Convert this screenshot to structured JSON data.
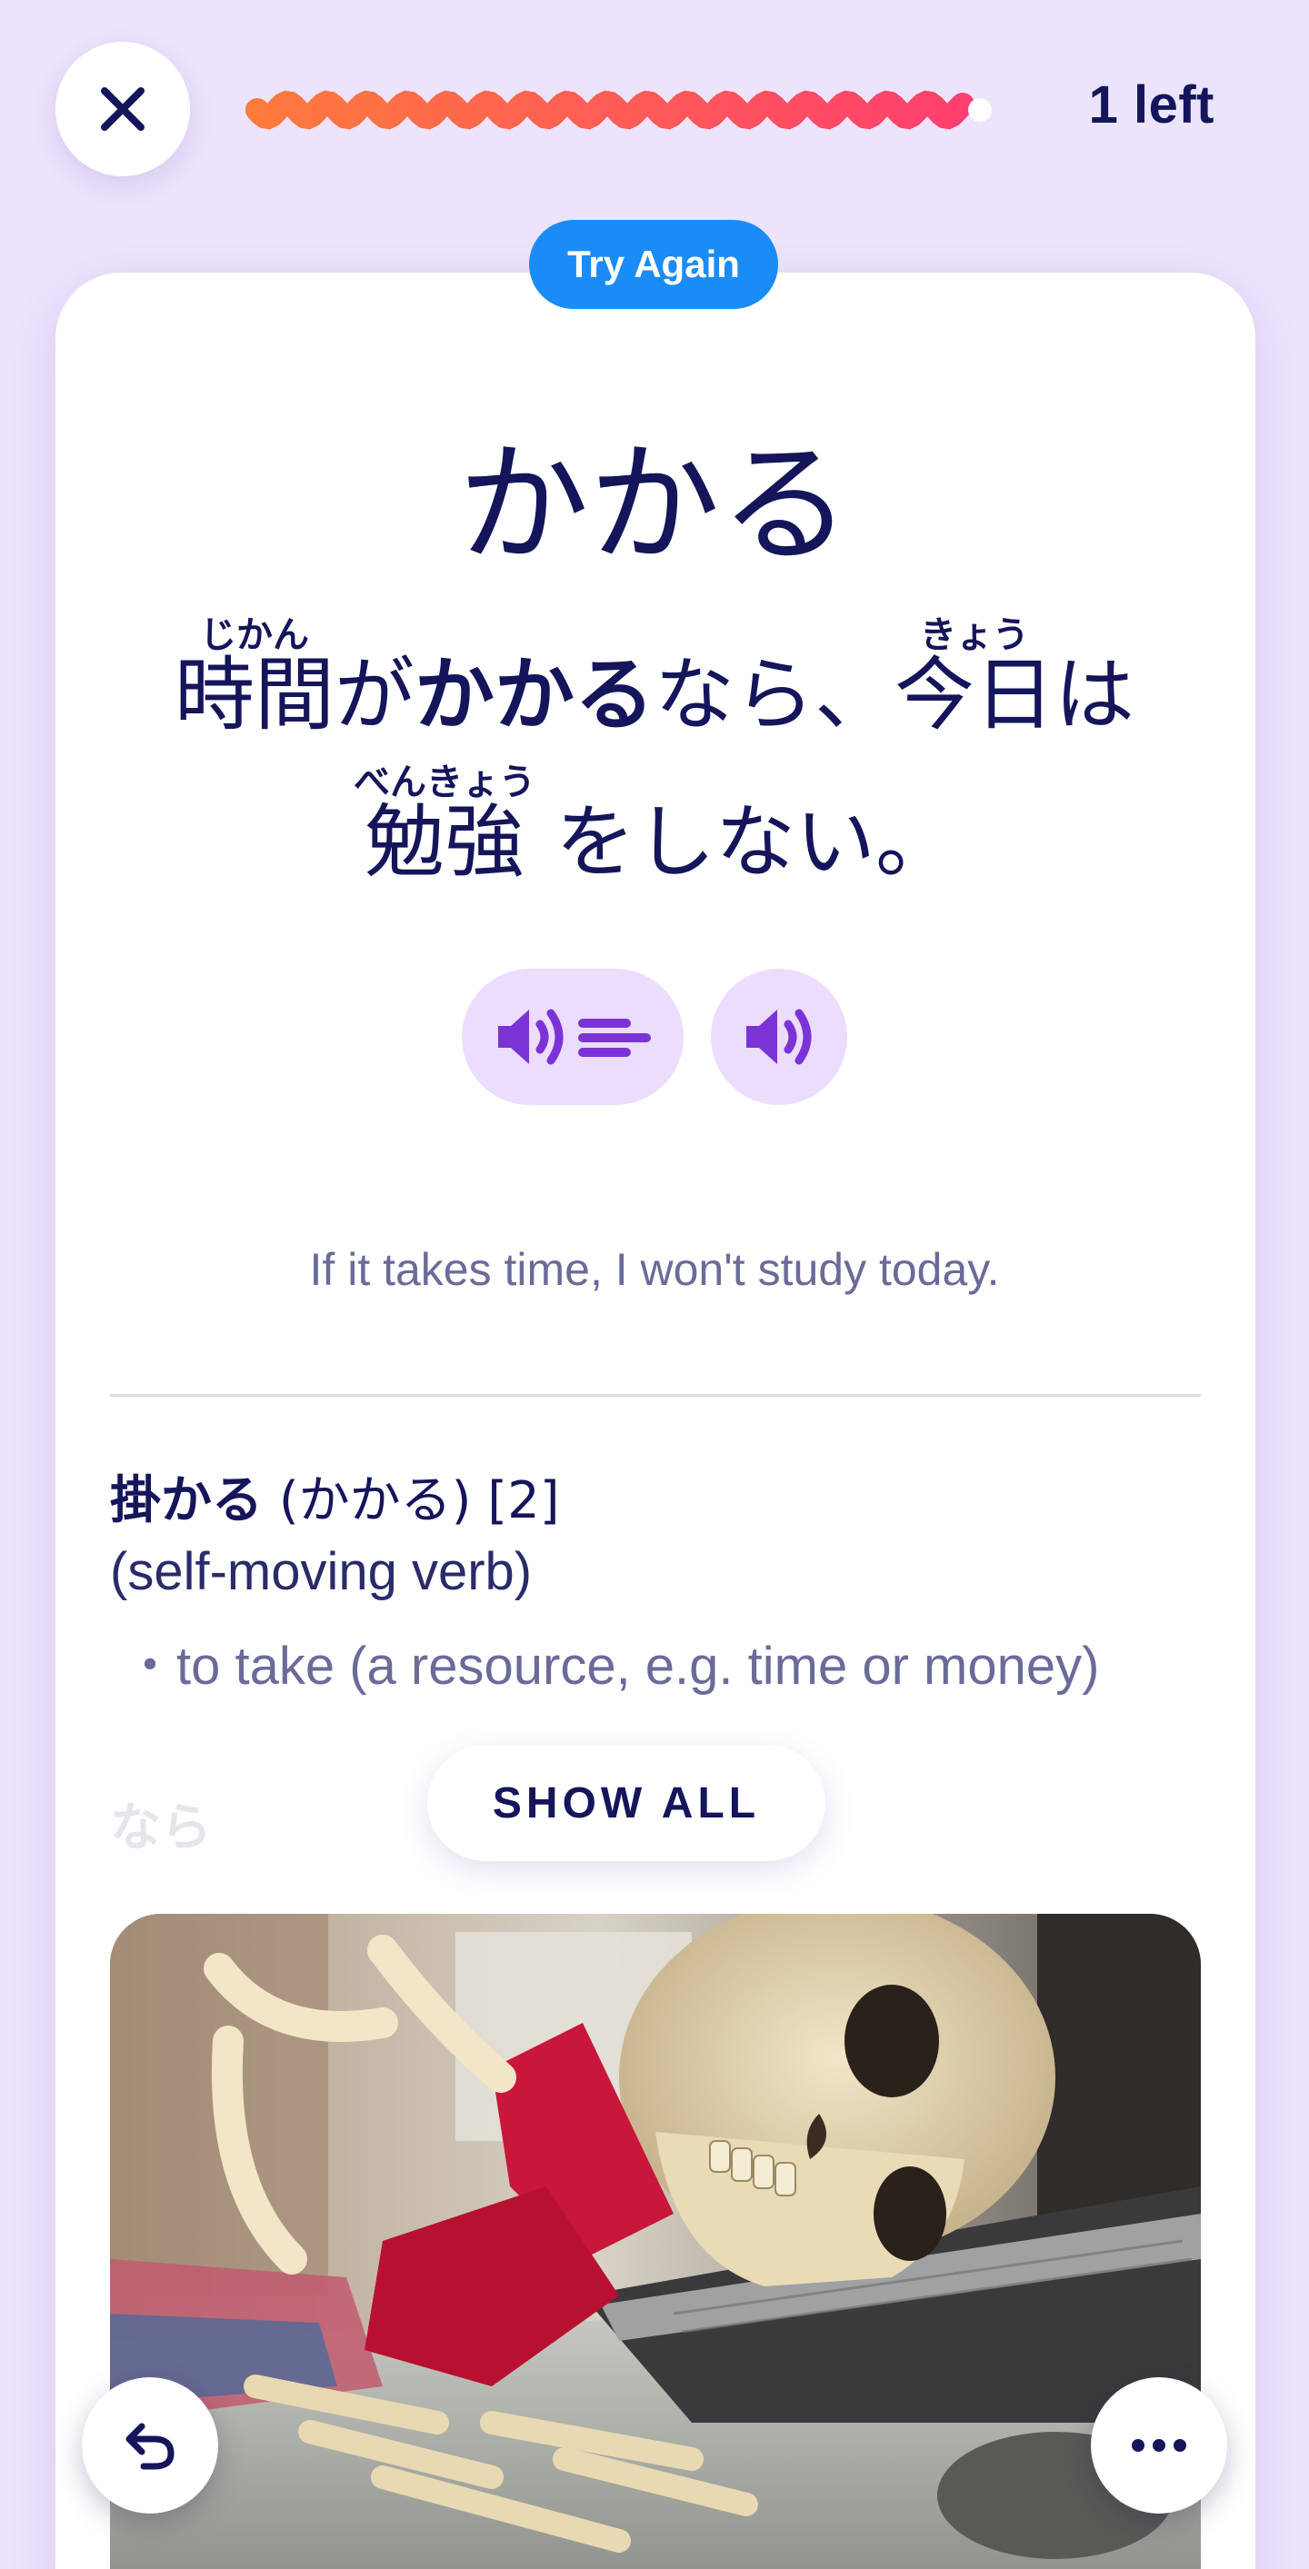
{
  "header": {
    "close_icon": "close-icon",
    "progress_fraction": 0.97,
    "remaining_label": "1 left"
  },
  "card": {
    "badge": "Try Again",
    "headword": "かかる",
    "sentence": {
      "line1": [
        {
          "text": "時間",
          "reading": "じかん"
        },
        {
          "text": "が"
        },
        {
          "text": "かかる",
          "bold": true
        },
        {
          "text": "なら、"
        },
        {
          "text": "今日",
          "reading": "きょう"
        },
        {
          "text": "は"
        }
      ],
      "line2": [
        {
          "text": "勉強",
          "reading": "べんきょう"
        },
        {
          "text": " をしない。"
        }
      ]
    },
    "audio": {
      "slow_icon": "speaker-slow-icon",
      "normal_icon": "speaker-icon"
    },
    "translation": "If it takes time, I won't study today.",
    "entry": {
      "kanji": "掛かる",
      "reading": "(かかる) [2]",
      "type": "(self-moving verb)",
      "definition": "・to take (a resource, e.g. time or money)"
    },
    "next_entry_faded": "なら",
    "show_all_label": "SHOW ALL",
    "image_subject": "skeleton-at-desk-photo"
  },
  "footer": {
    "undo_icon": "undo-icon",
    "more_icon": "more-dots-icon"
  },
  "colors": {
    "background": "#ece3fc",
    "text_primary": "#14155a",
    "badge_blue": "#1b8cf5",
    "audio_button": "#ecdcfe",
    "audio_icon": "#7b33d6",
    "progress_start": "#ff7a3d",
    "progress_end": "#ff3f6e"
  }
}
